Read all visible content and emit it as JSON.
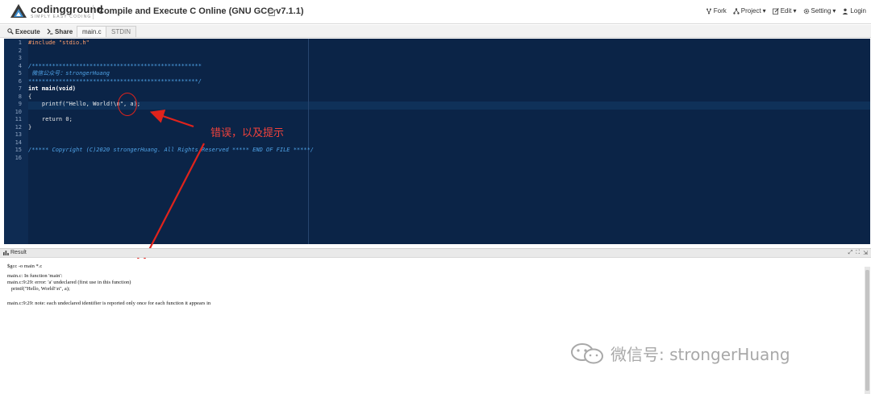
{
  "header": {
    "logo_name": "codingground",
    "logo_tagline": "SIMPLY EASY CODING",
    "page_title": "Compile and Execute C Online (GNU GCC v7.1.1)",
    "menu": [
      {
        "label": "Fork",
        "icon": "fork-icon"
      },
      {
        "label": "Project",
        "icon": "project-icon"
      },
      {
        "label": "Edit",
        "icon": "edit-icon"
      },
      {
        "label": "Setting",
        "icon": "gear-icon"
      },
      {
        "label": "Login",
        "icon": "user-icon"
      }
    ]
  },
  "toolbar": {
    "execute_label": "Execute",
    "share_label": "Share",
    "tabs": [
      "main.c",
      "STDIN"
    ]
  },
  "editor": {
    "line_numbers": [
      "1",
      "2",
      "3",
      "4",
      "5",
      "6",
      "7",
      "8",
      "9",
      "10",
      "11",
      "12",
      "13",
      "14",
      "15",
      "16"
    ],
    "lines": [
      "#include \"stdio.h\"",
      "",
      "",
      "/**************************************************",
      " 微信公众号：strongerHuang",
      "**************************************************/",
      "int main(void)",
      "{",
      "    printf(\"Hello, World!\\n\", a);",
      "",
      "    return 0;",
      "}",
      "",
      "",
      "/***** Copyright (C)2020 strongerHuang. All Rights Reserved ***** END OF FILE *****/",
      ""
    ]
  },
  "annotation": {
    "text": "错误，以及提示"
  },
  "result": {
    "title": "Result",
    "output_lines": [
      "$gcc -o main *.c",
      "main.c: In function 'main':",
      "main.c:9:29: error: 'a' undeclared (first use in this function)",
      "   printf(\"Hello, World!\\n\", a);",
      "",
      "main.c:9:29: note: each undeclared identifier is reported only once for each function it appears in"
    ]
  },
  "watermark": {
    "text": "微信号: strongerHuang"
  },
  "colors": {
    "editor_bg": "#0b2447",
    "annotation_red": "#e0231c",
    "brand_blue": "#3d8fd1"
  }
}
